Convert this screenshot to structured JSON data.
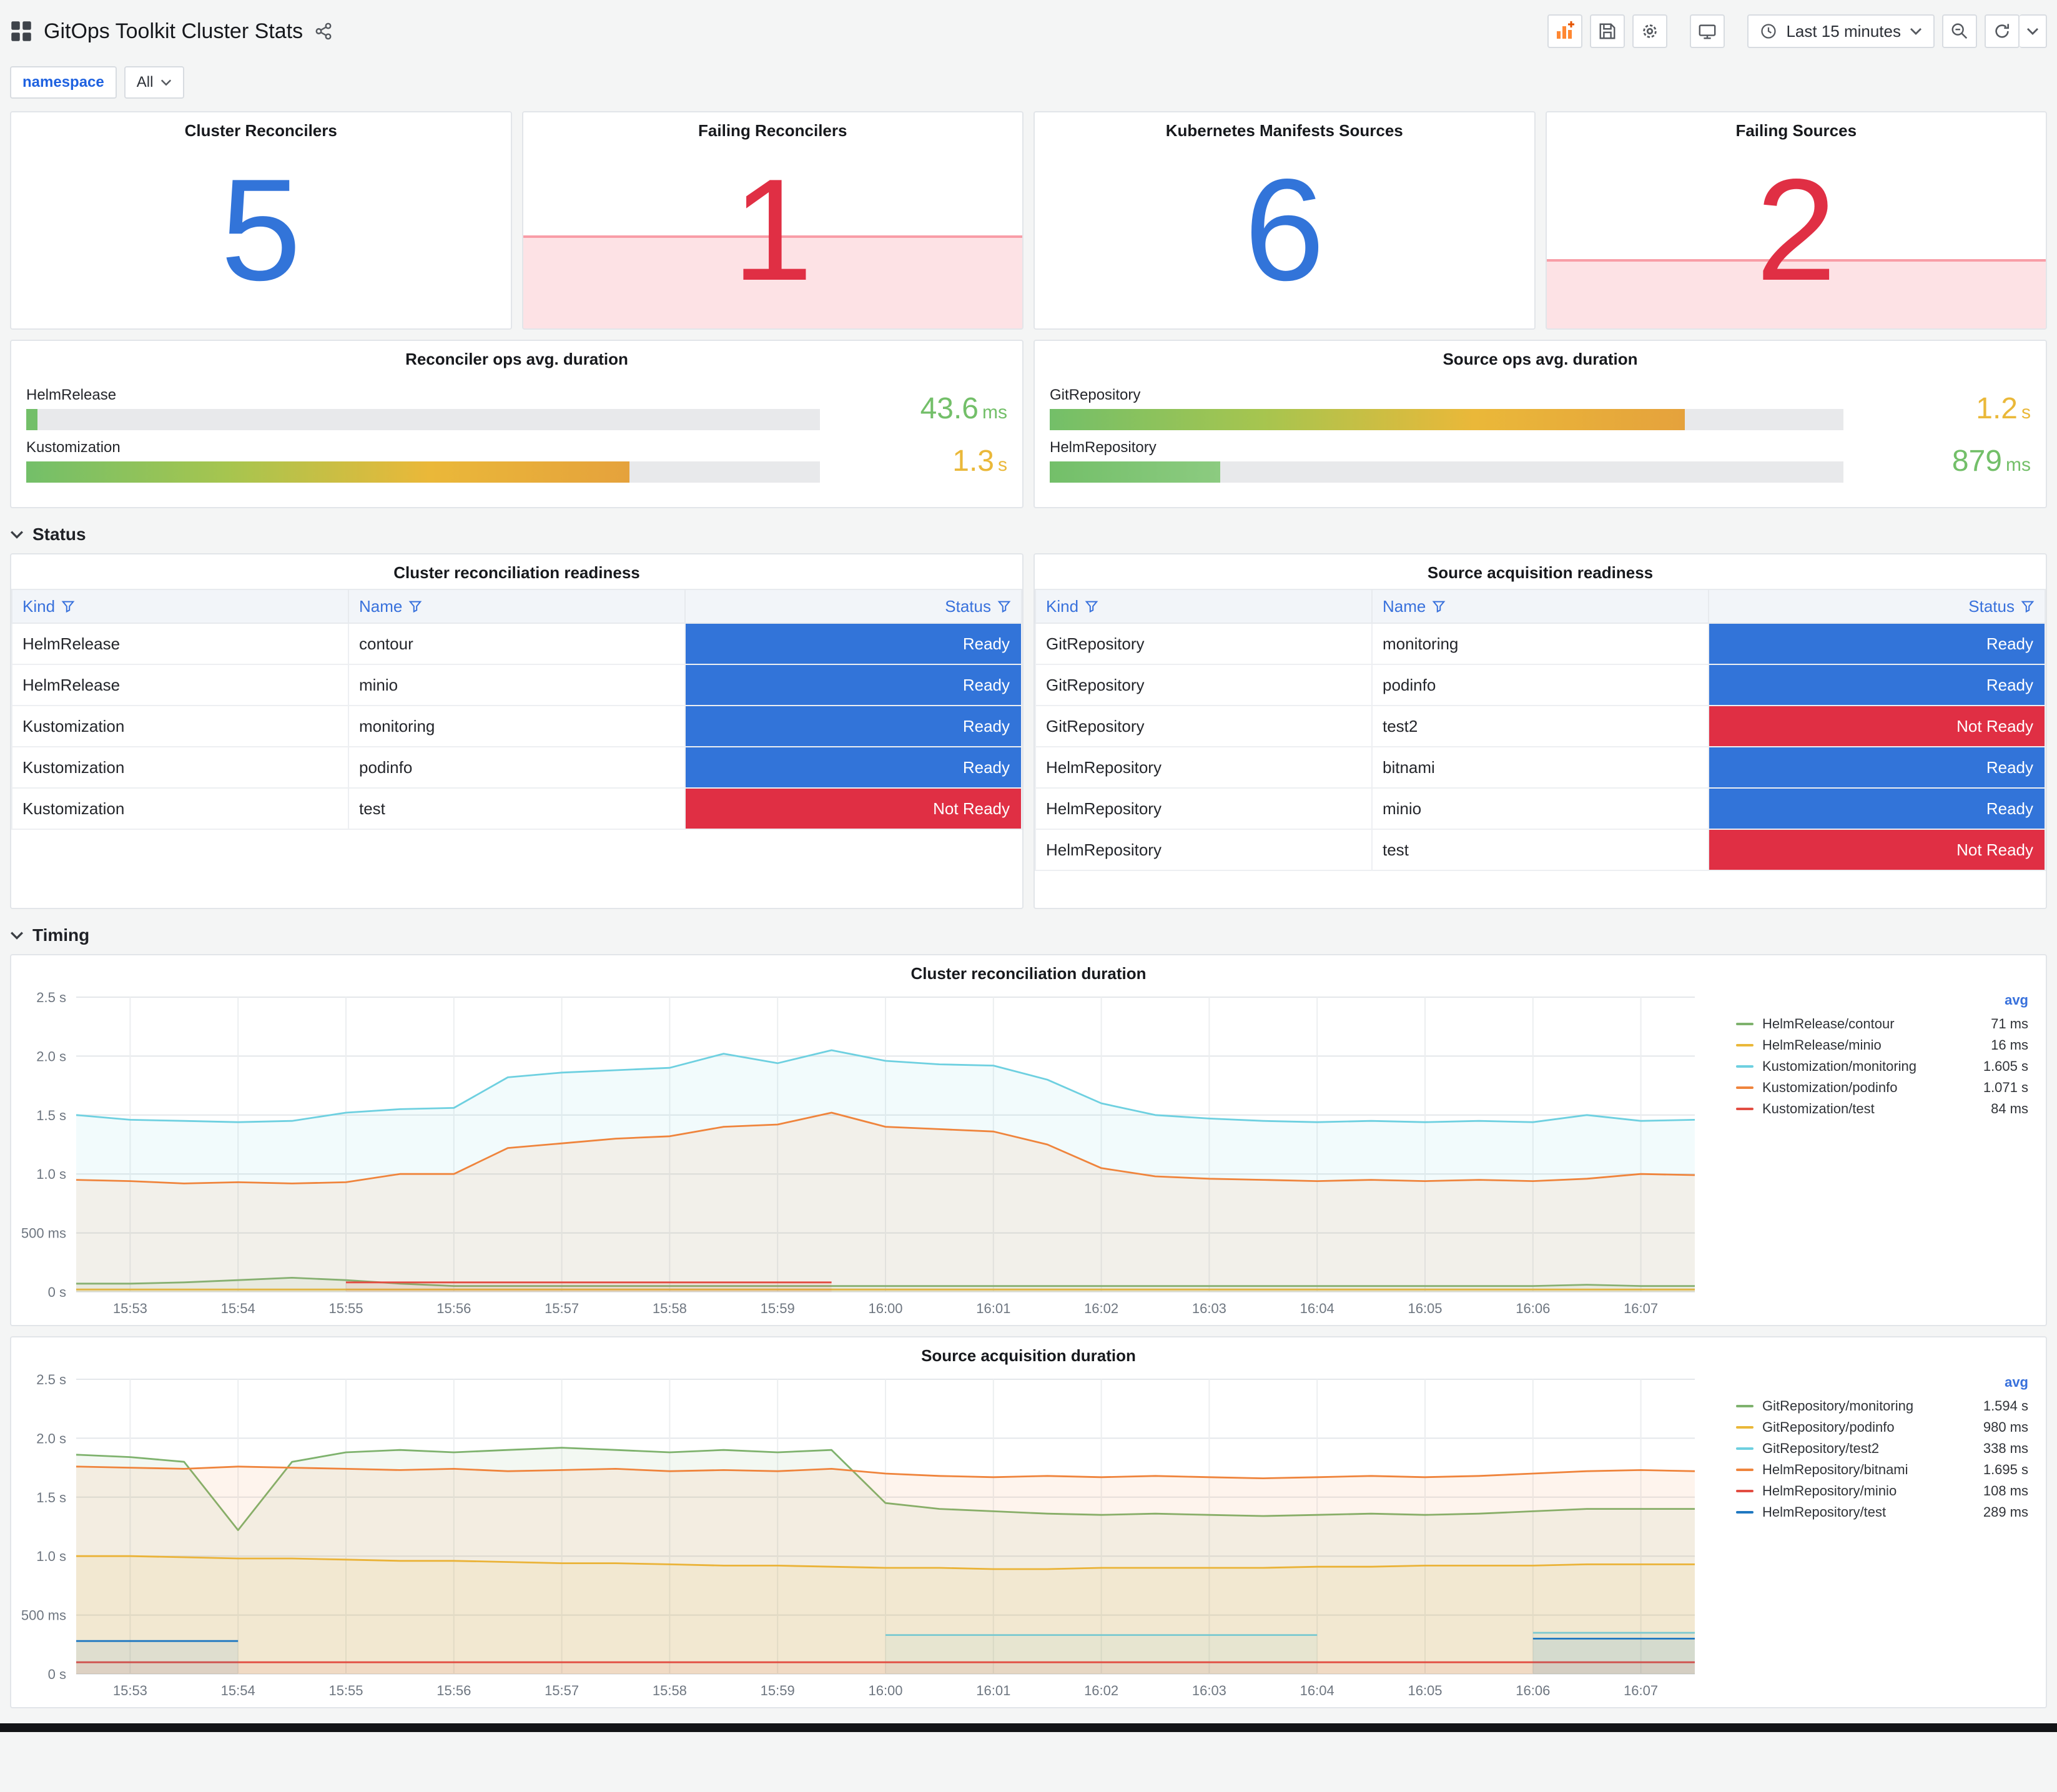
{
  "header": {
    "title": "GitOps Toolkit Cluster Stats",
    "time_range_label": "Last 15 minutes",
    "toolbar_icons": [
      "dashboards-grid",
      "share",
      "add-panel",
      "save",
      "settings",
      "tv-mode",
      "clock",
      "zoom-out",
      "refresh",
      "refresh-interval-caret"
    ]
  },
  "variables": {
    "label": "namespace",
    "value": "All"
  },
  "sections": {
    "status": "Status",
    "timing": "Timing"
  },
  "colors": {
    "blue": "#3274D9",
    "red": "#E02F44",
    "green": "#73BF69",
    "yellow": "#EAB839"
  },
  "stats": [
    {
      "title": "Cluster Reconcilers",
      "value": "5",
      "color": "#3274D9",
      "alert_fill_pct": 0
    },
    {
      "title": "Failing Reconcilers",
      "value": "1",
      "color": "#E02F44",
      "alert_fill_pct": 43
    },
    {
      "title": "Kubernetes Manifests Sources",
      "value": "6",
      "color": "#3274D9",
      "alert_fill_pct": 0
    },
    {
      "title": "Failing Sources",
      "value": "2",
      "color": "#E02F44",
      "alert_fill_pct": 32
    }
  ],
  "gauges": [
    {
      "title": "Reconciler ops avg. duration",
      "rows": [
        {
          "label": "HelmRelease",
          "pct": 1.4,
          "value": "43.6",
          "unit": "ms",
          "value_color": "#73BF69",
          "bar_colors": [
            "#73BF69"
          ]
        },
        {
          "label": "Kustomization",
          "pct": 76,
          "value": "1.3",
          "unit": "s",
          "value_color": "#EAB839",
          "bar_colors": [
            "#73BF69",
            "#A6C54F",
            "#EAB839",
            "#E5A23C"
          ]
        }
      ]
    },
    {
      "title": "Source ops avg. duration",
      "rows": [
        {
          "label": "GitRepository",
          "pct": 80,
          "value": "1.2",
          "unit": "s",
          "value_color": "#EAB839",
          "bar_colors": [
            "#73BF69",
            "#A6C54F",
            "#EAB839",
            "#E5A23C"
          ]
        },
        {
          "label": "HelmRepository",
          "pct": 21.5,
          "value": "879",
          "unit": "ms",
          "value_color": "#73BF69",
          "bar_colors": [
            "#73BF69",
            "#8CCB80"
          ]
        }
      ]
    }
  ],
  "status_colors": {
    "ready": "#3274D9",
    "not_ready": "#E02F44"
  },
  "tables": [
    {
      "title": "Cluster reconciliation readiness",
      "columns": [
        "Kind",
        "Name",
        "Status"
      ],
      "rows": [
        {
          "kind": "HelmRelease",
          "name": "contour",
          "status": "Ready"
        },
        {
          "kind": "HelmRelease",
          "name": "minio",
          "status": "Ready"
        },
        {
          "kind": "Kustomization",
          "name": "monitoring",
          "status": "Ready"
        },
        {
          "kind": "Kustomization",
          "name": "podinfo",
          "status": "Ready"
        },
        {
          "kind": "Kustomization",
          "name": "test",
          "status": "Not Ready"
        }
      ]
    },
    {
      "title": "Source acquisition readiness",
      "columns": [
        "Kind",
        "Name",
        "Status"
      ],
      "rows": [
        {
          "kind": "GitRepository",
          "name": "monitoring",
          "status": "Ready"
        },
        {
          "kind": "GitRepository",
          "name": "podinfo",
          "status": "Ready"
        },
        {
          "kind": "GitRepository",
          "name": "test2",
          "status": "Not Ready"
        },
        {
          "kind": "HelmRepository",
          "name": "bitnami",
          "status": "Ready"
        },
        {
          "kind": "HelmRepository",
          "name": "minio",
          "status": "Ready"
        },
        {
          "kind": "HelmRepository",
          "name": "test",
          "status": "Not Ready"
        }
      ]
    }
  ],
  "chart_data": [
    {
      "type": "line",
      "title": "Cluster reconciliation duration",
      "xlabel": "",
      "ylabel": "",
      "ylim": [
        0,
        2.5
      ],
      "yticks": [
        {
          "v": 0,
          "label": "0 s"
        },
        {
          "v": 0.5,
          "label": "500 ms"
        },
        {
          "v": 1.0,
          "label": "1.0 s"
        },
        {
          "v": 1.5,
          "label": "1.5 s"
        },
        {
          "v": 2.0,
          "label": "2.0 s"
        },
        {
          "v": 2.5,
          "label": "2.5 s"
        }
      ],
      "xticks": [
        "15:53",
        "15:54",
        "15:55",
        "15:56",
        "15:57",
        "15:58",
        "15:59",
        "16:00",
        "16:01",
        "16:02",
        "16:03",
        "16:04",
        "16:05",
        "16:06",
        "16:07"
      ],
      "legend_header": "avg",
      "series": [
        {
          "name": "HelmRelease/contour",
          "avg": "71 ms",
          "color": "#7EB26D",
          "values": [
            0.07,
            0.07,
            0.08,
            0.1,
            0.12,
            0.1,
            0.07,
            0.05,
            0.05,
            0.05,
            0.05,
            0.05,
            0.05,
            0.05,
            0.05,
            0.05,
            0.05,
            0.05,
            0.05,
            0.05,
            0.05,
            0.05,
            0.05,
            0.05,
            0.05,
            0.05,
            0.05,
            0.05,
            0.06,
            0.05,
            0.05
          ]
        },
        {
          "name": "HelmRelease/minio",
          "avg": "16 ms",
          "color": "#EAB839",
          "values": [
            0.02,
            0.02,
            0.02,
            0.02,
            0.02,
            0.02,
            0.02,
            0.02,
            0.02,
            0.02,
            0.02,
            0.02,
            0.02,
            0.02,
            0.02,
            0.02,
            0.02,
            0.02,
            0.02,
            0.02,
            0.02,
            0.02,
            0.02,
            0.02,
            0.02,
            0.02,
            0.02,
            0.02,
            0.02,
            0.02,
            0.02
          ]
        },
        {
          "name": "Kustomization/monitoring",
          "avg": "1.605 s",
          "color": "#6ED0E0",
          "values": [
            1.5,
            1.46,
            1.45,
            1.44,
            1.45,
            1.52,
            1.55,
            1.56,
            1.82,
            1.86,
            1.88,
            1.9,
            2.02,
            1.94,
            2.05,
            1.96,
            1.93,
            1.92,
            1.8,
            1.6,
            1.5,
            1.47,
            1.45,
            1.44,
            1.45,
            1.44,
            1.45,
            1.44,
            1.5,
            1.45,
            1.46
          ]
        },
        {
          "name": "Kustomization/podinfo",
          "avg": "1.071 s",
          "color": "#EF843C",
          "values": [
            0.95,
            0.94,
            0.92,
            0.93,
            0.92,
            0.93,
            1.0,
            1.0,
            1.22,
            1.26,
            1.3,
            1.32,
            1.4,
            1.42,
            1.52,
            1.4,
            1.38,
            1.36,
            1.25,
            1.05,
            0.98,
            0.96,
            0.95,
            0.94,
            0.95,
            0.94,
            0.95,
            0.94,
            0.96,
            1.0,
            0.99
          ]
        },
        {
          "name": "Kustomization/test",
          "avg": "84 ms",
          "color": "#E24D42",
          "values": [
            null,
            null,
            null,
            null,
            null,
            0.08,
            0.08,
            0.08,
            0.08,
            0.08,
            0.08,
            0.08,
            0.08,
            0.08,
            0.08,
            null,
            null,
            null,
            null,
            null,
            null,
            null,
            null,
            null,
            null,
            null,
            null,
            null,
            null,
            null,
            null
          ]
        }
      ]
    },
    {
      "type": "line",
      "title": "Source acquisition duration",
      "xlabel": "",
      "ylabel": "",
      "ylim": [
        0,
        2.5
      ],
      "yticks": [
        {
          "v": 0,
          "label": "0 s"
        },
        {
          "v": 0.5,
          "label": "500 ms"
        },
        {
          "v": 1.0,
          "label": "1.0 s"
        },
        {
          "v": 1.5,
          "label": "1.5 s"
        },
        {
          "v": 2.0,
          "label": "2.0 s"
        },
        {
          "v": 2.5,
          "label": "2.5 s"
        }
      ],
      "xticks": [
        "15:53",
        "15:54",
        "15:55",
        "15:56",
        "15:57",
        "15:58",
        "15:59",
        "16:00",
        "16:01",
        "16:02",
        "16:03",
        "16:04",
        "16:05",
        "16:06",
        "16:07"
      ],
      "legend_header": "avg",
      "series": [
        {
          "name": "GitRepository/monitoring",
          "avg": "1.594 s",
          "color": "#7EB26D",
          "values": [
            1.86,
            1.84,
            1.8,
            1.22,
            1.8,
            1.88,
            1.9,
            1.88,
            1.9,
            1.92,
            1.9,
            1.88,
            1.9,
            1.88,
            1.9,
            1.45,
            1.4,
            1.38,
            1.36,
            1.35,
            1.36,
            1.35,
            1.34,
            1.35,
            1.36,
            1.35,
            1.36,
            1.38,
            1.4,
            1.4,
            1.4
          ]
        },
        {
          "name": "GitRepository/podinfo",
          "avg": "980 ms",
          "color": "#EAB839",
          "values": [
            1.0,
            1.0,
            0.99,
            0.98,
            0.98,
            0.97,
            0.96,
            0.96,
            0.95,
            0.94,
            0.94,
            0.93,
            0.92,
            0.92,
            0.91,
            0.9,
            0.9,
            0.89,
            0.89,
            0.9,
            0.9,
            0.9,
            0.9,
            0.91,
            0.91,
            0.92,
            0.92,
            0.92,
            0.93,
            0.93,
            0.93
          ]
        },
        {
          "name": "GitRepository/test2",
          "avg": "338 ms",
          "color": "#6ED0E0",
          "values": [
            null,
            null,
            null,
            null,
            null,
            null,
            null,
            null,
            null,
            null,
            null,
            null,
            null,
            null,
            null,
            0.33,
            0.33,
            0.33,
            0.33,
            0.33,
            0.33,
            0.33,
            0.33,
            0.33,
            null,
            null,
            null,
            0.35,
            0.35,
            0.35,
            0.35
          ]
        },
        {
          "name": "HelmRepository/bitnami",
          "avg": "1.695 s",
          "color": "#EF843C",
          "values": [
            1.76,
            1.75,
            1.74,
            1.76,
            1.75,
            1.74,
            1.73,
            1.74,
            1.72,
            1.73,
            1.74,
            1.72,
            1.73,
            1.72,
            1.74,
            1.7,
            1.68,
            1.67,
            1.68,
            1.67,
            1.68,
            1.67,
            1.66,
            1.67,
            1.68,
            1.67,
            1.68,
            1.7,
            1.72,
            1.73,
            1.72
          ]
        },
        {
          "name": "HelmRepository/minio",
          "avg": "108 ms",
          "color": "#E24D42",
          "values": [
            0.1,
            0.1,
            0.1,
            0.1,
            0.1,
            0.1,
            0.1,
            0.1,
            0.1,
            0.1,
            0.1,
            0.1,
            0.1,
            0.1,
            0.1,
            0.1,
            0.1,
            0.1,
            0.1,
            0.1,
            0.1,
            0.1,
            0.1,
            0.1,
            0.1,
            0.1,
            0.1,
            0.1,
            0.1,
            0.1,
            0.1
          ]
        },
        {
          "name": "HelmRepository/test",
          "avg": "289 ms",
          "color": "#1F78C1",
          "values": [
            0.28,
            0.28,
            0.28,
            0.28,
            null,
            null,
            null,
            null,
            null,
            null,
            null,
            null,
            null,
            null,
            null,
            null,
            null,
            null,
            null,
            null,
            null,
            null,
            null,
            null,
            null,
            null,
            null,
            0.3,
            0.3,
            0.3,
            0.3
          ]
        }
      ]
    }
  ]
}
